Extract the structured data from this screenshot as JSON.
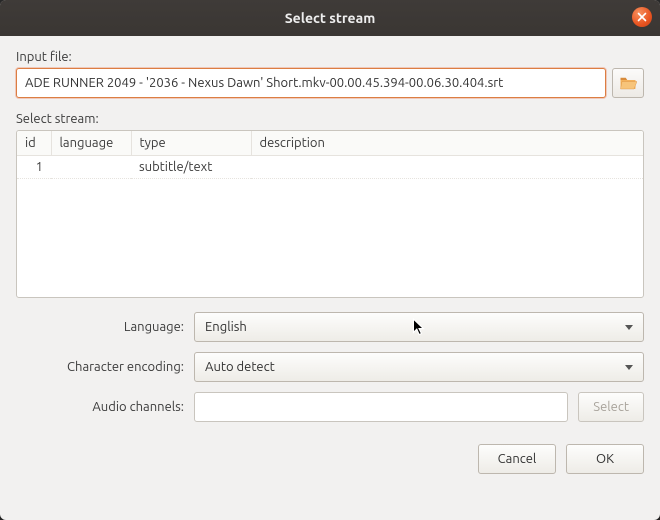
{
  "window": {
    "title": "Select stream"
  },
  "input_file": {
    "label": "Input file:",
    "value": "ADE RUNNER 2049 - '2036 - Nexus Dawn' Short.mkv-00.00.45.394-00.06.30.404.srt"
  },
  "stream": {
    "label": "Select stream:",
    "columns": {
      "id": "id",
      "language": "language",
      "type": "type",
      "description": "description"
    },
    "rows": [
      {
        "id": "1",
        "language": "",
        "type": "subtitle/text",
        "description": ""
      }
    ]
  },
  "form": {
    "language_label": "Language:",
    "language_value": "English",
    "encoding_label": "Character encoding:",
    "encoding_value": "Auto detect",
    "audio_label": "Audio channels:",
    "audio_value": "",
    "select_label": "Select"
  },
  "buttons": {
    "cancel": "Cancel",
    "ok": "OK"
  }
}
